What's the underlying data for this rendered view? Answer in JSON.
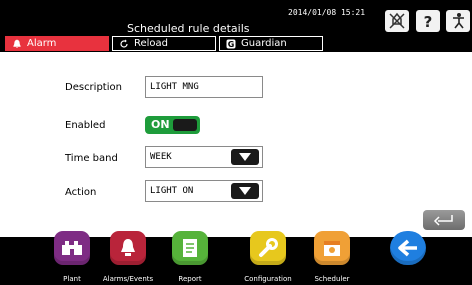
{
  "header": {
    "title": "Scheduled rule details",
    "datetime": "2014/01/08 15:21"
  },
  "tabs": [
    {
      "label": "Alarm",
      "icon": "bell-icon"
    },
    {
      "label": "Reload",
      "icon": "reload-icon"
    },
    {
      "label": "Guardian",
      "icon": "guardian-icon"
    }
  ],
  "form": {
    "description_label": "Description",
    "description_value": "LIGHT MNG",
    "enabled_label": "Enabled",
    "enabled_value": "ON",
    "timeband_label": "Time band",
    "timeband_value": "WEEK",
    "action_label": "Action",
    "action_value": "LIGHT ON"
  },
  "nav": [
    {
      "label": "Plant",
      "color": "#7e2c84",
      "icon": "plant-icon"
    },
    {
      "label": "Alarms/Events",
      "color": "#b9243a",
      "icon": "alarms-icon"
    },
    {
      "label": "Report",
      "color": "#56b33a",
      "icon": "report-icon"
    },
    {
      "label": "Configuration",
      "color": "#e7c81d",
      "icon": "wrench-icon"
    },
    {
      "label": "Scheduler",
      "color": "#f0a036",
      "icon": "scheduler-icon"
    },
    {
      "label": "",
      "color": "#1f7fe0",
      "icon": "back-arrow-icon"
    }
  ]
}
